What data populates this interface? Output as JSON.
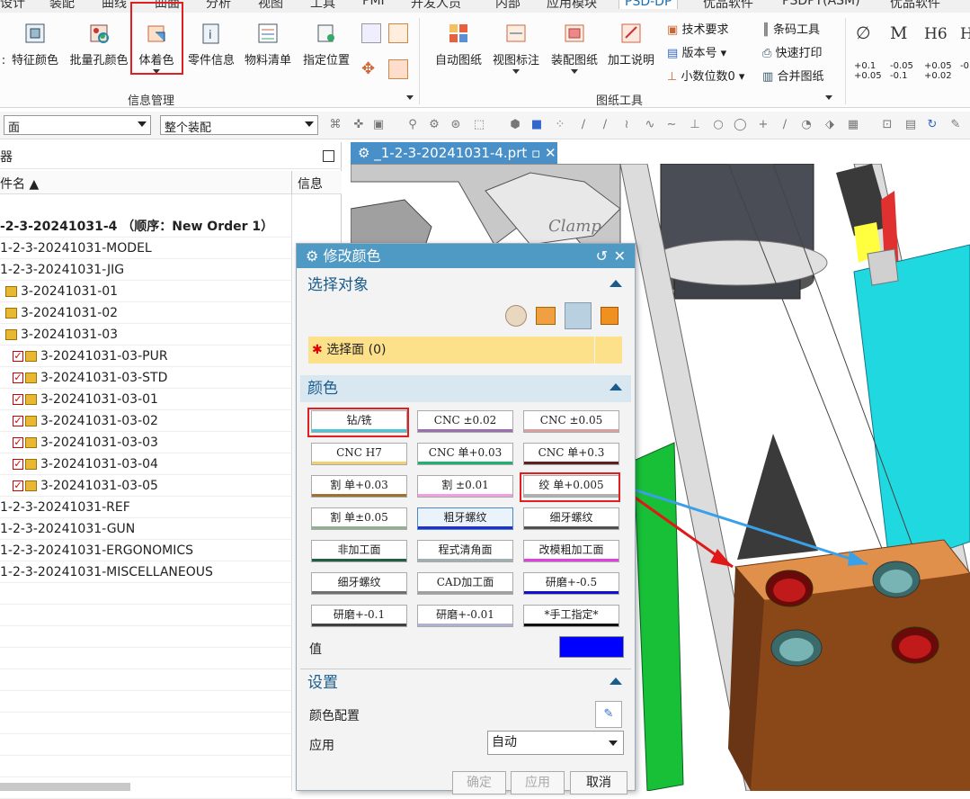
{
  "ribbon": {
    "tabs": [
      "设计",
      "装配",
      "曲线",
      "曲面",
      "分析",
      "视图",
      "工具",
      "PMI",
      "开发人员",
      "内部",
      "应用模块",
      "PSD-DP",
      "优品软件",
      "PSDPT(ASM)",
      "优品软件"
    ],
    "info_buttons": [
      {
        "label": "特征颜色",
        "icon": "feature-color-icon"
      },
      {
        "label": "批量孔颜色",
        "icon": "batch-hole-color-icon"
      },
      {
        "label": "体着色",
        "icon": "body-shading-icon"
      },
      {
        "label": "零件信息",
        "icon": "part-info-icon"
      },
      {
        "label": "物料清单",
        "icon": "bom-icon"
      },
      {
        "label": "指定位置",
        "icon": "specify-position-icon"
      }
    ],
    "info_group_label": "信息管理",
    "drawing_buttons": [
      {
        "label": "自动图纸",
        "icon": "auto-drawing-icon"
      },
      {
        "label": "视图标注",
        "icon": "view-annotation-icon"
      },
      {
        "label": "装配图纸",
        "icon": "assembly-drawing-icon"
      },
      {
        "label": "加工说明",
        "icon": "machining-note-icon"
      }
    ],
    "drawing_small": [
      "技术要求",
      "版本号",
      "小数位数0",
      "条码工具",
      "快速打印",
      "合并图纸"
    ],
    "drawing_group_label": "图纸工具",
    "tolerance": {
      "symbols": [
        "∅",
        "M",
        "H6",
        "H"
      ],
      "values": [
        "+0.1\n+0.05",
        "-0.05\n-0.1",
        "+0.05\n+0.02",
        "-0"
      ]
    }
  },
  "toolbar": {
    "filter_value": "面",
    "scope_value": "整个装配"
  },
  "navigator": {
    "title": "器",
    "col_name": "件名",
    "col_info": "信息",
    "rows": [
      {
        "text": "-2-3-20241031-4 （顺序：New Order 1）",
        "bold": true
      },
      {
        "text": "1-2-3-20241031-MODEL"
      },
      {
        "text": "1-2-3-20241031-JIG"
      },
      {
        "text": "3-20241031-01"
      },
      {
        "text": "3-20241031-02"
      },
      {
        "text": "3-20241031-03"
      },
      {
        "text": "3-20241031-03-PUR"
      },
      {
        "text": "3-20241031-03-STD"
      },
      {
        "text": "3-20241031-03-01"
      },
      {
        "text": "3-20241031-03-02"
      },
      {
        "text": "3-20241031-03-03"
      },
      {
        "text": "3-20241031-03-04"
      },
      {
        "text": "3-20241031-03-05"
      },
      {
        "text": "1-2-3-20241031-REF"
      },
      {
        "text": "1-2-3-20241031-GUN"
      },
      {
        "text": "1-2-3-20241031-ERGONOMICS"
      },
      {
        "text": "1-2-3-20241031-MISCELLANEOUS"
      }
    ]
  },
  "viewport": {
    "tab_label": "_1-2-3-20241031-4.prt",
    "model_text": "Clamp"
  },
  "dialog": {
    "title": "修改颜色",
    "section_select": "选择对象",
    "select_face": "选择面 (0)",
    "section_color": "颜色",
    "colors": [
      {
        "label": "钻/铣",
        "bar": "#4ec3d8"
      },
      {
        "label": "CNC ±0.02",
        "bar": "#9a6fb0"
      },
      {
        "label": "CNC ±0.05",
        "bar": "#d8a0a0"
      },
      {
        "label": "CNC H7",
        "bar": "#f0d070"
      },
      {
        "label": "CNC 单+0.03",
        "bar": "#20b070"
      },
      {
        "label": "CNC 单+0.3",
        "bar": "#602020"
      },
      {
        "label": "割 单+0.03",
        "bar": "#a07030"
      },
      {
        "label": "割 ±0.01",
        "bar": "#f0a0e0"
      },
      {
        "label": "绞 单+0.005",
        "bar": "#b0b0b0"
      },
      {
        "label": "割 单±0.05",
        "bar": "#90b090"
      },
      {
        "label": "粗牙螺纹",
        "bar": "#2030d0"
      },
      {
        "label": "细牙螺纹",
        "bar": "#505050"
      },
      {
        "label": "非加工面",
        "bar": "#206040"
      },
      {
        "label": "程式清角面",
        "bar": "#a0b0b0"
      },
      {
        "label": "改模粗加工面",
        "bar": "#e040e0"
      },
      {
        "label": "细牙螺纹",
        "bar": "#707070"
      },
      {
        "label": "CAD加工面",
        "bar": "#a0a0a0"
      },
      {
        "label": "研磨+-0.5",
        "bar": "#1010d0"
      },
      {
        "label": "研磨+-0.1",
        "bar": "#404040"
      },
      {
        "label": "研磨+-0.01",
        "bar": "#b0b0d0"
      },
      {
        "label": "*手工指定*",
        "bar": "#111111"
      }
    ],
    "value_label": "值",
    "value_color": "#0000ff",
    "section_settings": "设置",
    "color_config_label": "颜色配置",
    "apply_label": "应用",
    "apply_value": "自动",
    "ok_label": "确定",
    "apply_btn_label": "应用",
    "cancel_label": "取消"
  }
}
